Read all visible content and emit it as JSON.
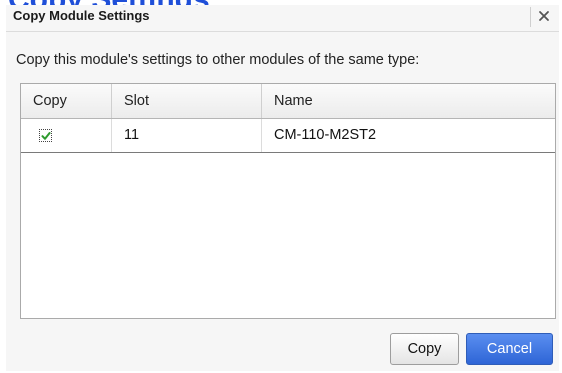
{
  "background": {
    "heading": "Copy Settings"
  },
  "dialog": {
    "title": "Copy Module Settings",
    "close_icon": "close-icon",
    "instructions": "Copy this module's settings to other modules of the same type:",
    "columns": {
      "copy": "Copy",
      "slot": "Slot",
      "name": "Name"
    },
    "rows": [
      {
        "copy_checked": true,
        "slot": "11",
        "name": "CM-110-M2ST2"
      }
    ],
    "buttons": {
      "copy": "Copy",
      "cancel": "Cancel"
    }
  },
  "colors": {
    "heading_blue": "#1f4fd8",
    "primary_button": "#2e65d6",
    "check_green": "#2e9b2e"
  }
}
